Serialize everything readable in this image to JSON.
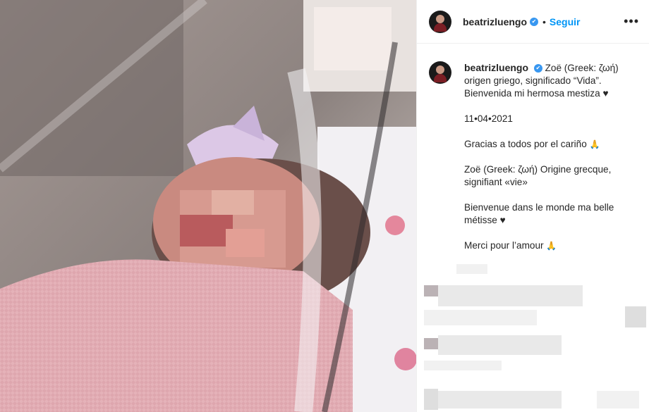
{
  "post": {
    "username": "beatrizluengo",
    "verified_mark": "✔",
    "separator": "•",
    "follow_label": "Seguir",
    "more_label": "•••"
  },
  "caption": {
    "username": "beatrizluengo",
    "line1": "Zoë (Greek: ζωή) origen griego, significado “Vida”. Bienvenida mi hermosa mestiza ♥",
    "date": "11•04•2021",
    "thanks_es": "Gracias a todos por el cariño",
    "greek_fr": "Zoë (Greek: ζωή) Origine grecque, signifiant «vie»",
    "welcome_fr": "Bienvenue dans le monde ma belle métisse ♥",
    "thanks_fr": "Merci pour l’amour",
    "pray_emoji": "🙏"
  },
  "colors": {
    "accent": "#0095f6",
    "verified": "#3897f0",
    "text": "#262626",
    "blanket": "#e8b6bd"
  }
}
